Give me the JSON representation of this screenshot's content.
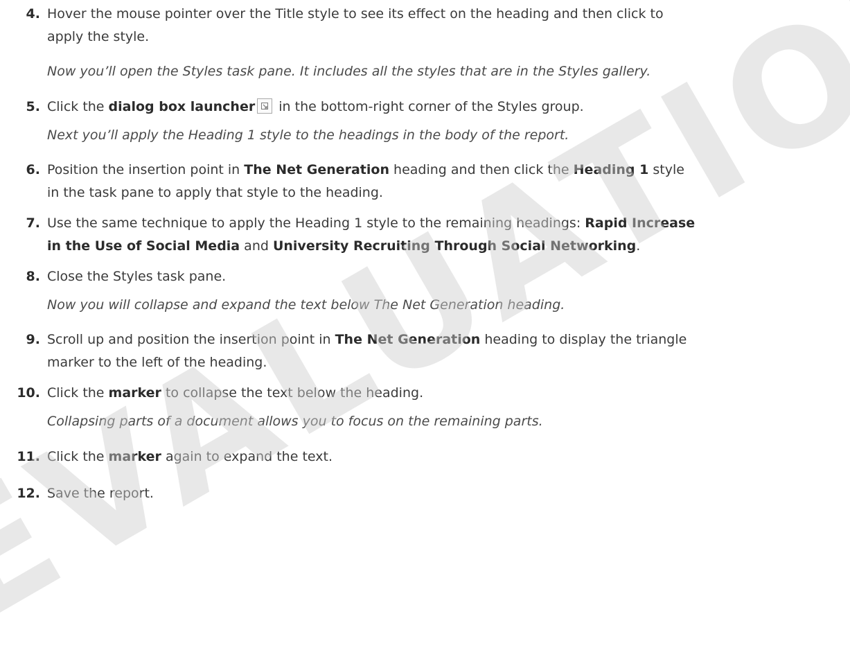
{
  "watermark": "EVALUATION COPY",
  "steps": [
    {
      "num": "4.",
      "lines": [
        "Hover the mouse pointer over the Title style to see its effect on the heading and then click to",
        "apply the style."
      ]
    },
    {
      "num": "5.",
      "pre": "Click the ",
      "b1": "dialog box launcher",
      "post": " in the bottom-right corner of the Styles group.",
      "icon": "dialog-box-launcher-icon"
    },
    {
      "num": "6.",
      "line1_pre": "Position the insertion point in ",
      "line1_b1": "The Net Generation",
      "line1_mid": " heading and then click the ",
      "line1_b2": "Heading 1",
      "line1_post": " style",
      "line2": "in the task pane to apply that style to the heading."
    },
    {
      "num": "7.",
      "line1_pre": "Use the same technique to apply the Heading 1 style to the remaining headings: ",
      "line1_b1": "Rapid Increase",
      "line2_b1": "in the Use of Social Media",
      "line2_mid": " and ",
      "line2_b2": "University Recruiting Through Social Networking",
      "line2_post": "."
    },
    {
      "num": "8.",
      "text": "Close the Styles task pane."
    },
    {
      "num": "9.",
      "line1_pre": "Scroll up and position the insertion point in ",
      "line1_b1": "The Net Generation",
      "line1_post": " heading to display the triangle",
      "line2": "marker to the left of the heading."
    },
    {
      "num": "10.",
      "pre": "Click the ",
      "b1": "marker",
      "post": " to collapse the text below the heading."
    },
    {
      "num": "11.",
      "pre": "Click the ",
      "b1": "marker",
      "post": " again to expand the text."
    },
    {
      "num": "12.",
      "text": "Save the report."
    }
  ],
  "notes": {
    "after_4": "Now you’ll open the Styles task pane. It includes all the styles that are in the Styles gallery.",
    "after_5": "Next you’ll apply the Heading 1 style to the headings in the body of the report.",
    "after_8": "Now you will collapse and expand the text below The Net Generation heading.",
    "after_10": "Collapsing parts of a document allows you to focus on the remaining parts."
  }
}
